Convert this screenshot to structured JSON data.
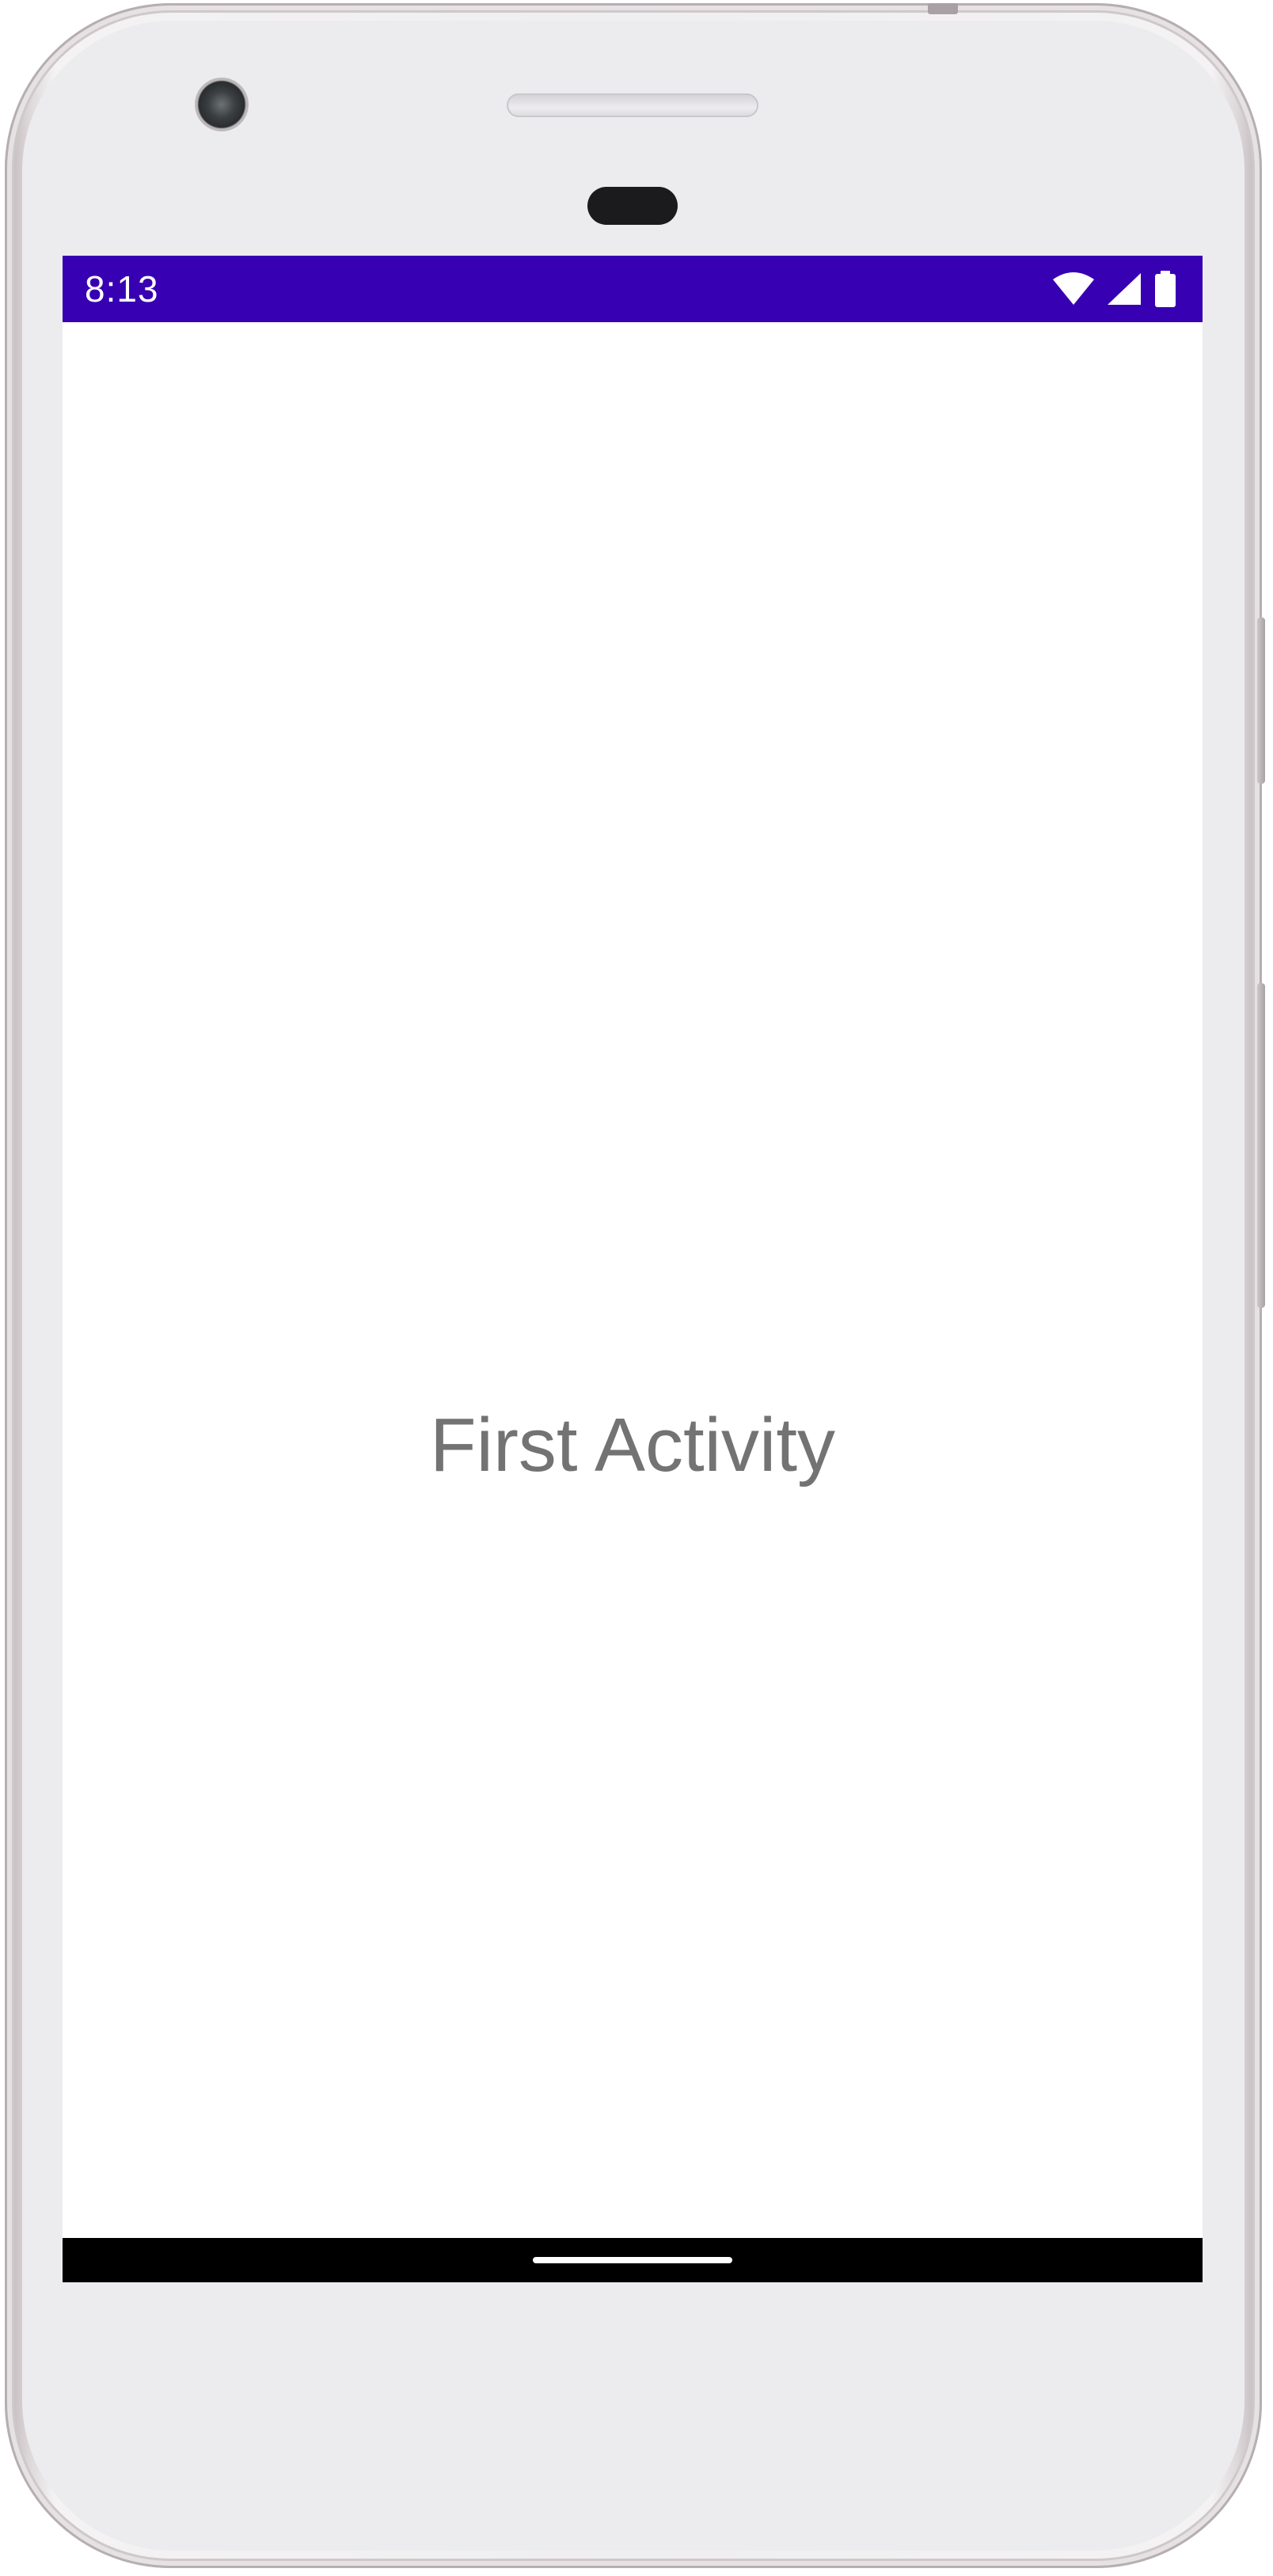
{
  "status_bar": {
    "time": "8:13",
    "background": "#3700b3",
    "icons": [
      "wifi-icon",
      "cellular-signal-icon",
      "battery-icon"
    ]
  },
  "main": {
    "label": "First Activity",
    "text_color": "#737373"
  },
  "navigation": {
    "background": "#000000",
    "home_indicator": "home-gesture-pill"
  }
}
